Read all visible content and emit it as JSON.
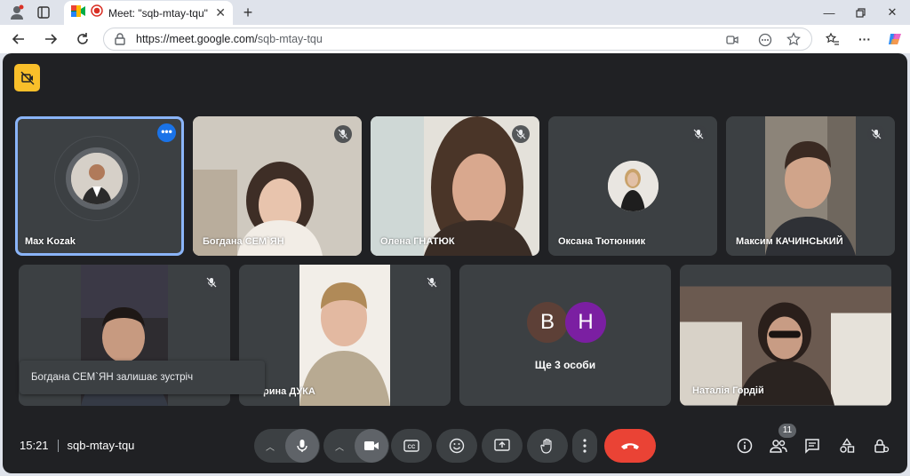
{
  "browser": {
    "tab_title": "Meet: \"sqb-mtay-tqu\"",
    "url_host": "https://meet.google.com/",
    "url_path": "sqb-mtay-tqu"
  },
  "participants_top": [
    {
      "name": "Max Kozak"
    },
    {
      "name": "Богдана СЕМ`ЯН"
    },
    {
      "name": "Олена ГНАТЮК"
    },
    {
      "name": "Оксана Тютюнник"
    },
    {
      "name": "Максим КАЧИНСЬКИЙ"
    }
  ],
  "participants_bottom": [
    {
      "name": ""
    },
    {
      "name": "Ірина ДУКА"
    },
    {
      "name": "Наталія Гордій"
    }
  ],
  "others": {
    "letters": [
      "B",
      "H"
    ],
    "label": "Ще 3 особи",
    "colors": [
      "#5d4037",
      "#7b1fa2"
    ]
  },
  "toast": "Богдана СЕМ`ЯН залишає зустріч",
  "meeting": {
    "time": "15:21",
    "code": "sqb-mtay-tqu",
    "participant_count": "11"
  },
  "colors": {
    "accent": "#8ab4f8",
    "end_call": "#ea4335",
    "host_badge": "#f9bf2a"
  }
}
